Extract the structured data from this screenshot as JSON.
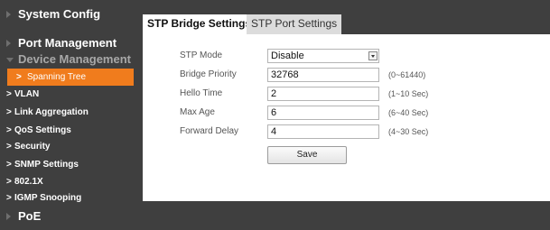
{
  "sidebar": {
    "categories": [
      {
        "label": "System Config",
        "expanded": false
      },
      {
        "label": "Port Management",
        "expanded": false
      },
      {
        "label": "Device Management",
        "expanded": true
      },
      {
        "label": "PoE",
        "expanded": false
      }
    ],
    "items": [
      {
        "label": "Spanning Tree",
        "active": true
      },
      {
        "label": "VLAN",
        "active": false
      },
      {
        "label": "Link Aggregation",
        "active": false
      },
      {
        "label": "QoS Settings",
        "active": false
      },
      {
        "label": "Security",
        "active": false
      },
      {
        "label": "SNMP Settings",
        "active": false
      },
      {
        "label": "802.1X",
        "active": false
      },
      {
        "label": "IGMP Snooping",
        "active": false
      }
    ]
  },
  "tabs": [
    {
      "label": "STP Bridge Settings",
      "active": true
    },
    {
      "label": "STP Port Settings",
      "active": false
    }
  ],
  "form": {
    "stp_mode": {
      "label": "STP Mode",
      "value": "Disable"
    },
    "bridge_priority": {
      "label": "Bridge Priority",
      "value": "32768",
      "hint": "(0~61440)"
    },
    "hello_time": {
      "label": "Hello Time",
      "value": "2",
      "hint": "(1~10 Sec)"
    },
    "max_age": {
      "label": "Max Age",
      "value": "6",
      "hint": "(6~40 Sec)"
    },
    "forward_delay": {
      "label": "Forward Delay",
      "value": "4",
      "hint": "(4~30 Sec)"
    },
    "save_label": "Save"
  },
  "colors": {
    "sidebar_bg": "#3f3f3f",
    "accent": "#f07c1d"
  }
}
